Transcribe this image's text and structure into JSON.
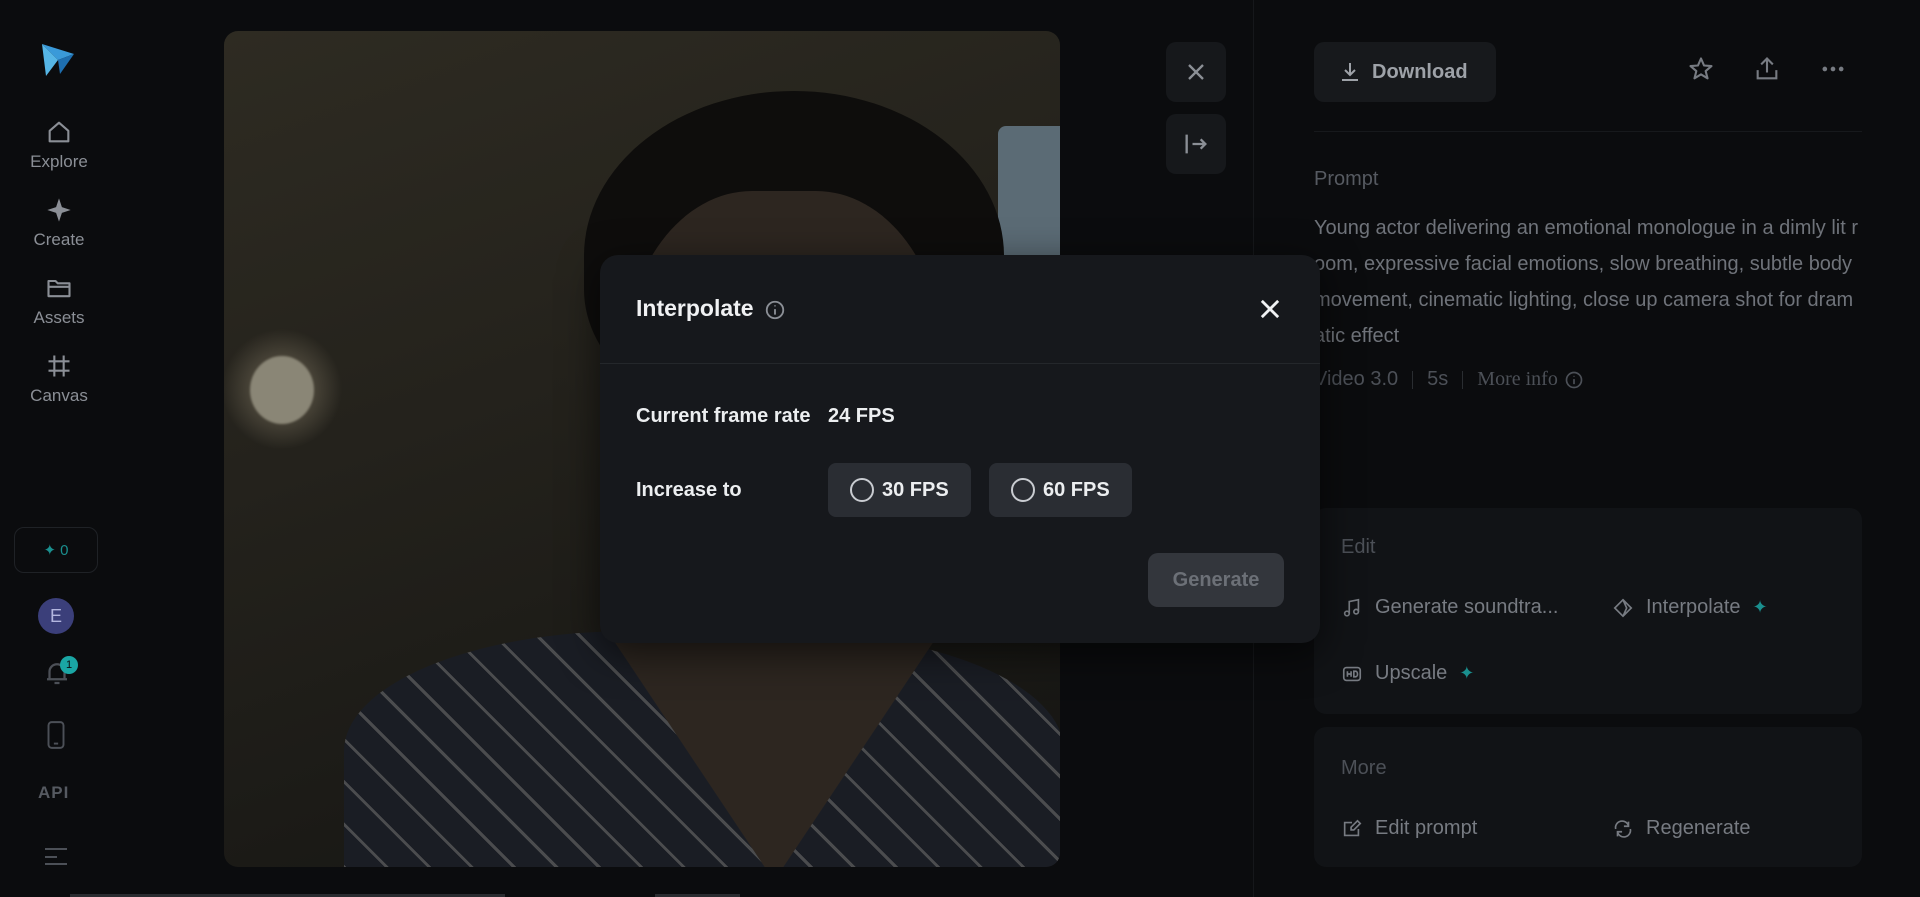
{
  "sidebar": {
    "items": [
      {
        "label": "Explore",
        "icon": "home-icon"
      },
      {
        "label": "Create",
        "icon": "sparkle-icon"
      },
      {
        "label": "Assets",
        "icon": "folder-icon"
      },
      {
        "label": "Canvas",
        "icon": "canvas-grid-icon"
      }
    ],
    "credits": "0",
    "avatar_initial": "E",
    "notification_count": "1",
    "api_label": "API"
  },
  "panel": {
    "download_label": "Download",
    "prompt_title": "Prompt",
    "prompt_text": "Young actor delivering an emotional monologue in a dimly lit room, expressive facial emotions, slow breathing, subtle body movement, cinematic lighting, close up camera shot for dramatic effect",
    "model": "Video 3.0",
    "duration": "5s",
    "more_info_label": "More info",
    "edit_title": "Edit",
    "edit_items": [
      {
        "label": "Generate soundtra...",
        "icon": "music-note-icon"
      },
      {
        "label": "Interpolate",
        "icon": "diamond-icon"
      },
      {
        "label": "Upscale",
        "icon": "hd-icon"
      }
    ],
    "more_title": "More",
    "more_items": [
      {
        "label": "Edit prompt",
        "icon": "edit-icon"
      },
      {
        "label": "Regenerate",
        "icon": "regenerate-icon"
      }
    ]
  },
  "modal": {
    "title": "Interpolate",
    "current_label": "Current frame rate",
    "current_value": "24 FPS",
    "increase_label": "Increase to",
    "options": [
      "30 FPS",
      "60 FPS"
    ],
    "generate_label": "Generate"
  },
  "colors": {
    "accent": "#1a8f8e",
    "background": "#0b0c0e",
    "modal": "#16181c"
  }
}
